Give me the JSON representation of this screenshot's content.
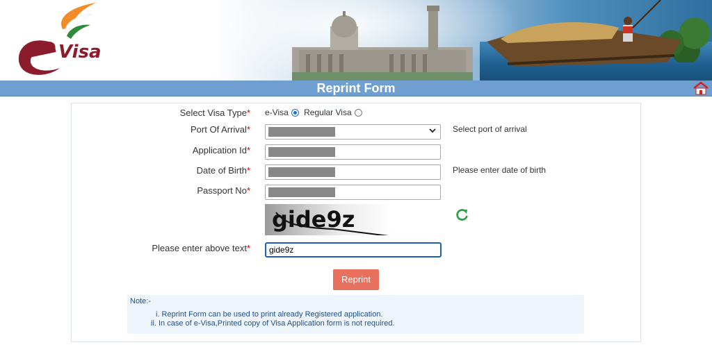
{
  "banner": {
    "logo_text": "Visa"
  },
  "header": {
    "title": "Reprint Form",
    "home_icon": "home-icon"
  },
  "form": {
    "visa_type": {
      "label": "Select Visa Type",
      "options": [
        "e-Visa",
        "Regular Visa"
      ],
      "selected": "e-Visa"
    },
    "port_of_arrival": {
      "label": "Port Of Arrival",
      "hint": "Select port of arrival"
    },
    "application_id": {
      "label": "Application Id"
    },
    "date_of_birth": {
      "label": "Date of Birth",
      "hint": "Please enter date of birth"
    },
    "passport_no": {
      "label": "Passport No"
    },
    "captcha": {
      "image_text": "gide9z",
      "label": "Please enter above text",
      "value": "gide9z",
      "refresh_icon": "refresh-icon"
    },
    "required_marker": "*",
    "submit_label": "Reprint"
  },
  "note": {
    "title": "Note:-",
    "items": [
      "i. Reprint Form can be used to print already Registered application.",
      "ii. In case of e-Visa,Printed copy of Visa Application form is not required."
    ]
  },
  "colors": {
    "title_bar": "#6f9fd0",
    "button": "#e8705c",
    "required": "#cc0000",
    "note_text": "#1f4f8f"
  }
}
